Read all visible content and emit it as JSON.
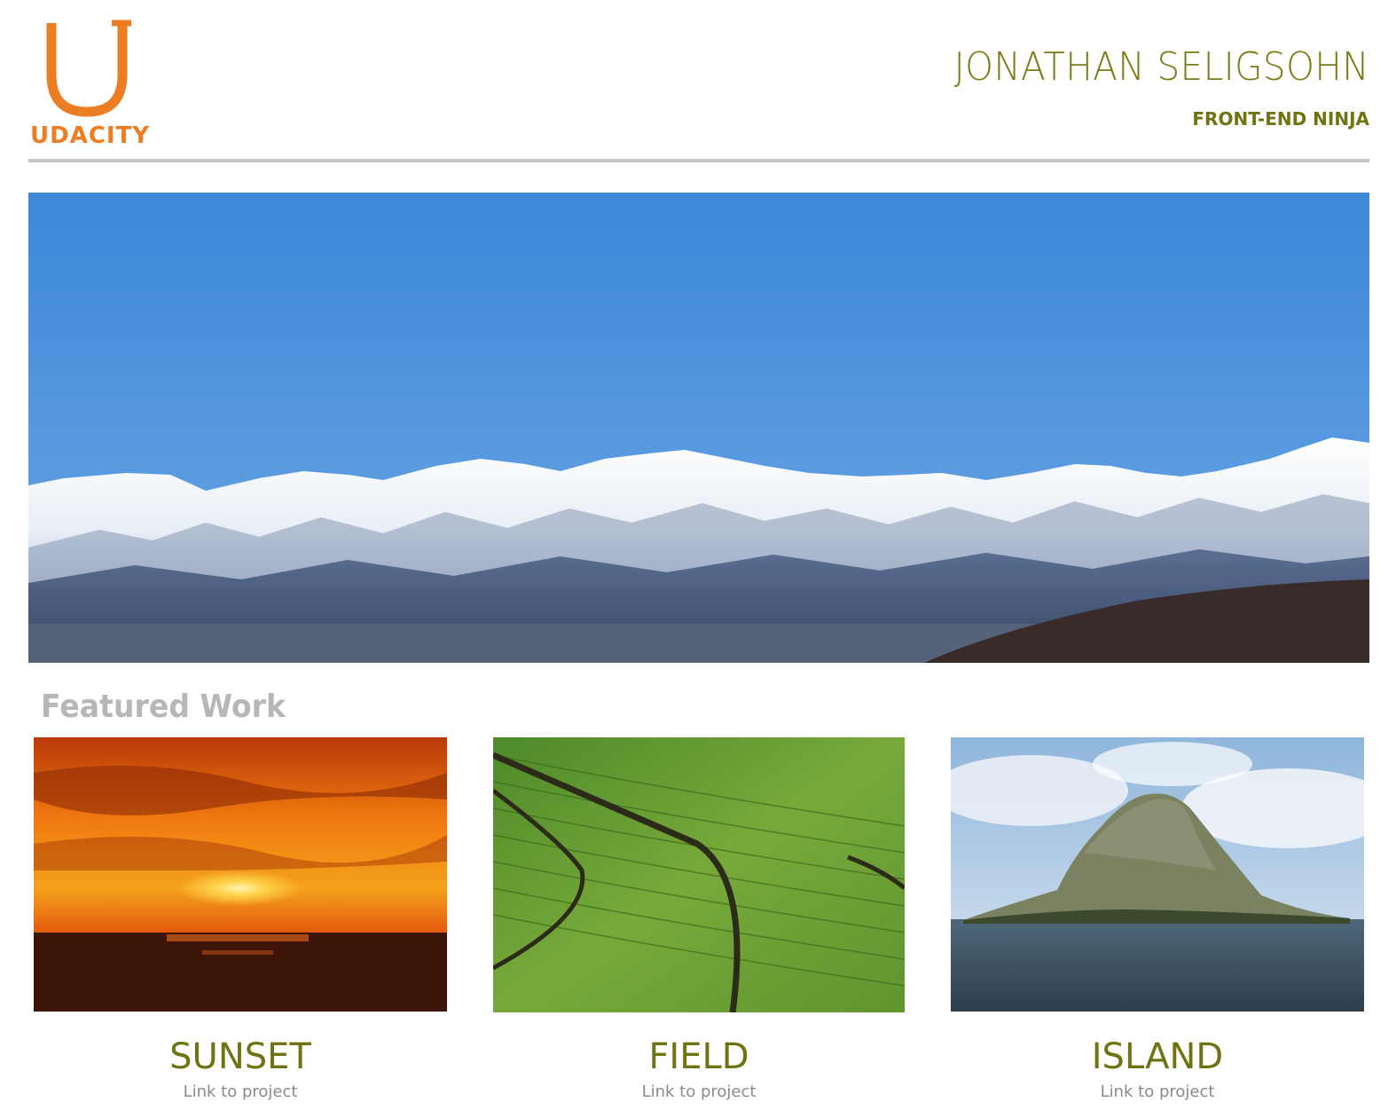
{
  "header": {
    "logo_letter": "U",
    "logo_text": "UDACITY",
    "name": "JONATHAN SELIGSOHN",
    "role": "FRONT-END NINJA"
  },
  "colors": {
    "brand_orange": "#ed7d22",
    "olive": "#6f7311",
    "divider_gray": "#c4c4c4",
    "heading_gray": "#b7b7b7",
    "link_gray": "#8a8a8a"
  },
  "hero": {
    "image_subject": "snow-capped-mountain-range"
  },
  "featured": {
    "heading": "Featured Work",
    "projects": [
      {
        "title": "SUNSET",
        "link_text": "Link to project",
        "image_subject": "sunset-over-sea"
      },
      {
        "title": "FIELD",
        "link_text": "Link to project",
        "image_subject": "green-crop-field"
      },
      {
        "title": "ISLAND",
        "link_text": "Link to project",
        "image_subject": "rocky-island"
      }
    ]
  }
}
